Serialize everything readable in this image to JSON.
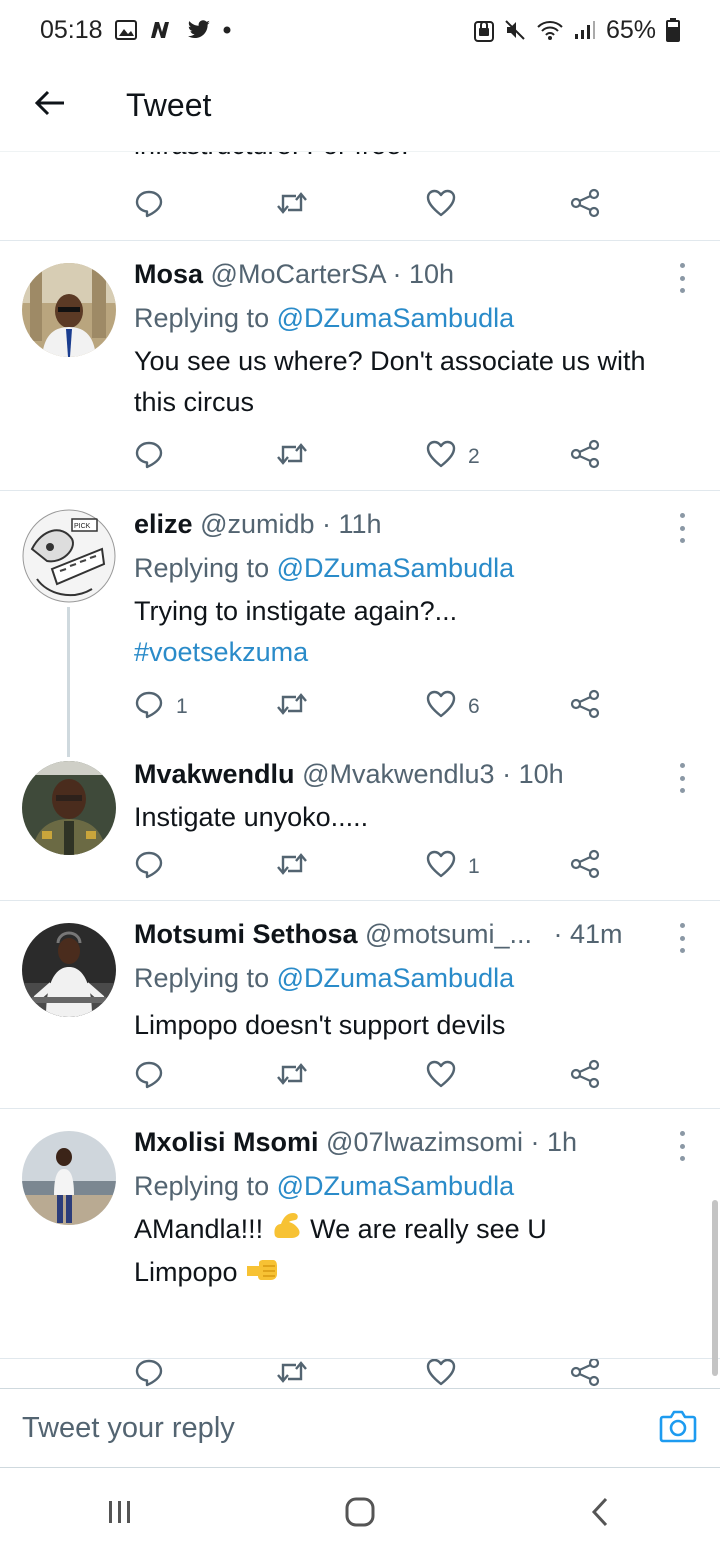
{
  "status_bar": {
    "time": "05:18",
    "battery": "65%"
  },
  "header": {
    "title": "Tweet"
  },
  "clipped_previous_text": "infrastructure! For free!",
  "tweets": [
    {
      "name": "Mosa",
      "handle": "@MoCarterSA",
      "time": "· 10h",
      "replying_prefix": "Replying to",
      "replying_to": "@DZumaSambudla",
      "text": "You see us where? Don't associate us with this circus",
      "reply_count": "",
      "retweet_count": "",
      "like_count": "2"
    },
    {
      "name": "elize",
      "handle": "@zumidb",
      "time": "· 11h",
      "replying_prefix": "Replying to",
      "replying_to": "@DZumaSambudla",
      "text": "Trying to instigate again?...",
      "hashtag": "#voetsekzuma",
      "reply_count": "1",
      "retweet_count": "",
      "like_count": "6"
    },
    {
      "name": "Mvakwendlu",
      "handle": "@Mvakwendlu3",
      "time": "· 10h",
      "text": "Instigate unyoko.....",
      "reply_count": "",
      "retweet_count": "",
      "like_count": "1"
    },
    {
      "name": "Motsumi Sethosa",
      "handle": "@motsumi_...",
      "time": "· 41m",
      "replying_prefix": "Replying to",
      "replying_to": "@DZumaSambudla",
      "text": "Limpopo doesn't support devils",
      "reply_count": "",
      "retweet_count": "",
      "like_count": ""
    },
    {
      "name": "Mxolisi Msomi",
      "handle": "@07lwazimsomi",
      "time": "· 1h",
      "replying_prefix": "Replying to",
      "replying_to": "@DZumaSambudla",
      "text_part1": "AMandla!!!",
      "text_part2": "We are really see U",
      "text_part3": "Limpopo",
      "reply_count": "",
      "retweet_count": "",
      "like_count": ""
    }
  ],
  "reply_bar": {
    "placeholder": "Tweet your reply"
  },
  "icons": {
    "back": "arrow-left-icon",
    "reply": "reply-icon",
    "retweet": "retweet-icon",
    "like": "heart-icon",
    "share": "share-icon",
    "camera": "camera-icon"
  },
  "colors": {
    "accent": "#1d9bf0",
    "text": "#0f1419",
    "muted": "#536471"
  }
}
